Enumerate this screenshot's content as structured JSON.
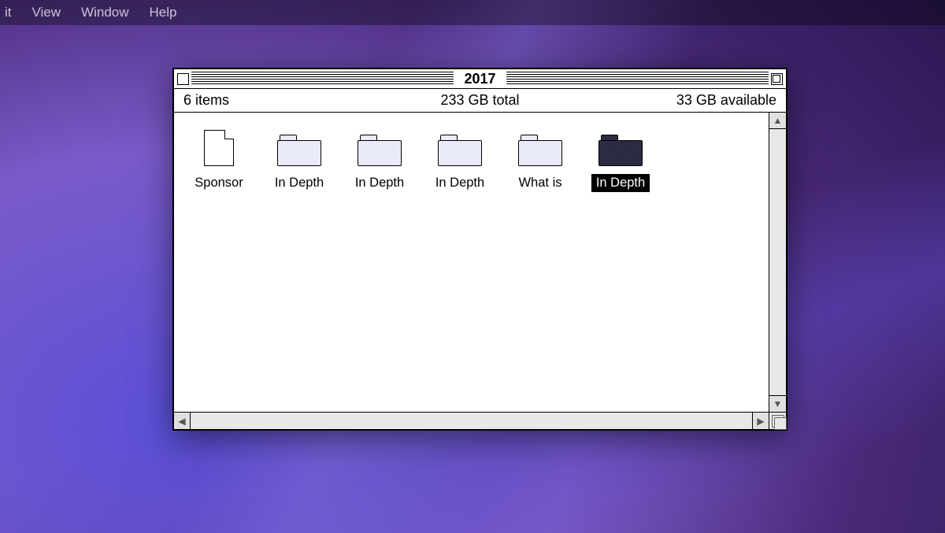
{
  "menubar": {
    "items": [
      "it",
      "View",
      "Window",
      "Help"
    ]
  },
  "window": {
    "title": "2017",
    "info": {
      "count": "6 items",
      "total": "233 GB total",
      "available": "33 GB available"
    },
    "items": [
      {
        "type": "doc",
        "label": "Sponsor",
        "selected": false
      },
      {
        "type": "folder",
        "label": "In Depth",
        "selected": false
      },
      {
        "type": "folder",
        "label": "In Depth",
        "selected": false
      },
      {
        "type": "folder",
        "label": "In Depth",
        "selected": false
      },
      {
        "type": "folder",
        "label": "What is",
        "selected": false
      },
      {
        "type": "folder",
        "label": "In Depth",
        "selected": true
      }
    ]
  },
  "glyphs": {
    "up": "▲",
    "down": "▼",
    "left": "◀",
    "right": "▶"
  }
}
